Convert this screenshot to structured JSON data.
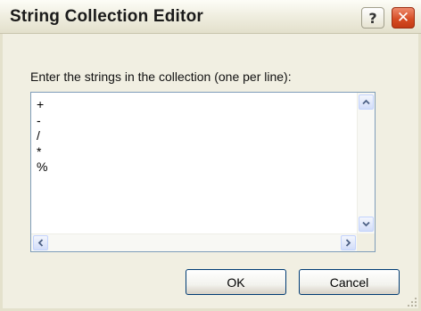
{
  "dialog": {
    "title": "String Collection Editor",
    "help_glyph": "?",
    "close_glyph": "✕",
    "instruction": "Enter the strings in the collection (one per line):",
    "lines": [
      "+",
      "-",
      "/",
      "*",
      "%"
    ],
    "ok_label": "OK",
    "cancel_label": "Cancel"
  },
  "icons": {
    "scroll_up": "arrow-up-icon",
    "scroll_down": "arrow-down-icon",
    "scroll_left": "arrow-left-icon",
    "scroll_right": "arrow-right-icon",
    "resize": "resize-grip-icon"
  },
  "colors": {
    "title_bar": "#eeecdd",
    "close_button": "#d44a22",
    "dialog_face": "#f1efe2",
    "button_border": "#003c74",
    "input_border": "#7f9db9"
  }
}
